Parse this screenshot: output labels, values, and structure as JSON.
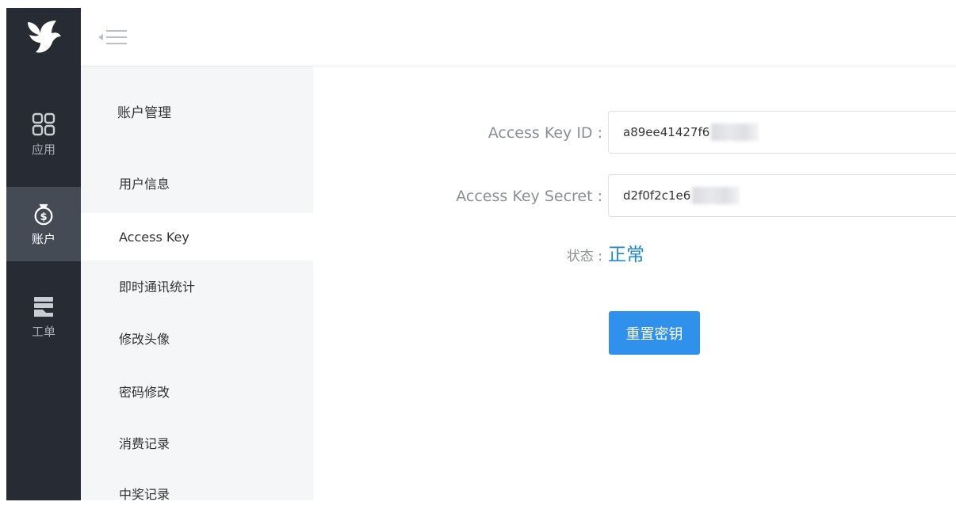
{
  "rail": {
    "items": [
      {
        "label": "应用",
        "icon": "grid-icon"
      },
      {
        "label": "账户",
        "icon": "money-bag-icon"
      },
      {
        "label": "工单",
        "icon": "ticket-stack-icon"
      }
    ],
    "active": "账户"
  },
  "submenu": {
    "title": "账户管理",
    "items": [
      {
        "label": "用户信息"
      },
      {
        "label": "Access Key"
      },
      {
        "label": "即时通讯统计"
      },
      {
        "label": "修改头像"
      },
      {
        "label": "密码修改"
      },
      {
        "label": "消费记录"
      },
      {
        "label": "中奖记录"
      }
    ],
    "active": "Access Key"
  },
  "form": {
    "key_id_label": "Access Key ID :",
    "key_id_value": "a89ee41427f6",
    "key_secret_label": "Access Key Secret :",
    "key_secret_value": "d2f0f2c1e6",
    "status_label": "状态 :",
    "status_value": "正常",
    "reset_button": "重置密钥"
  },
  "colors": {
    "rail_bg": "#272b33",
    "rail_active": "#454b55",
    "accent": "#2f91ec",
    "status": "#1e88d2"
  }
}
